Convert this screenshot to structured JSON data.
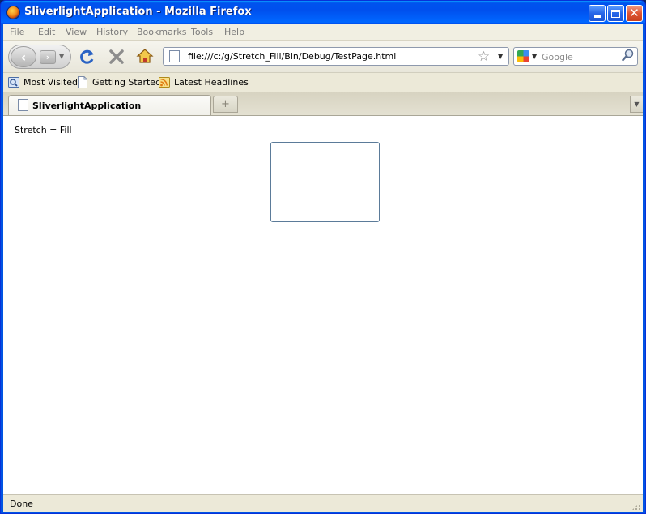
{
  "window": {
    "title": "SliverlightApplication - Mozilla Firefox",
    "controls": {
      "minimize": "minimize",
      "maximize": "maximize",
      "close": "✕"
    }
  },
  "menu": {
    "items": [
      {
        "label": "File"
      },
      {
        "label": "Edit"
      },
      {
        "label": "View"
      },
      {
        "label": "History"
      },
      {
        "label": "Bookmarks"
      },
      {
        "label": "Tools"
      },
      {
        "label": "Help"
      }
    ]
  },
  "navigation": {
    "back_glyph": "‹",
    "forward_glyph": "›",
    "url": "file:///c:/g/Stretch_Fill/Bin/Debug/TestPage.html",
    "search_placeholder": "Google"
  },
  "bookmarks": {
    "items": [
      {
        "label": "Most Visited",
        "icon": "most-visited-icon"
      },
      {
        "label": "Getting Started",
        "icon": "page-icon"
      },
      {
        "label": "Latest Headlines",
        "icon": "rss-feed-icon"
      }
    ]
  },
  "tabs": {
    "items": [
      {
        "label": "SliverlightApplication",
        "active": true
      }
    ],
    "new_tab_glyph": "+"
  },
  "content": {
    "text": "Stretch = Fill"
  },
  "status": {
    "text": "Done"
  },
  "colors": {
    "titlebar_blue": "#0054e3",
    "close_red": "#de5433",
    "chrome_beige": "#ece9d8",
    "box_border": "#5b7b99"
  }
}
